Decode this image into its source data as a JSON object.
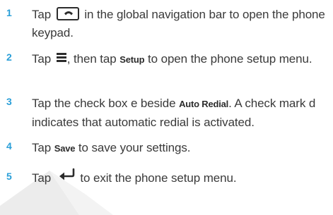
{
  "steps": [
    {
      "number": "1",
      "before_icon": "Tap ",
      "icon": "phone-handset-icon",
      "after_icon": " in the global navigation bar to open the phone keypad."
    },
    {
      "number": "2",
      "before_icon": "Tap ",
      "icon": "menu-icon",
      "after_icon": ", then tap ",
      "bold": "Setup",
      "after_bold": " to open the phone setup menu."
    },
    {
      "number": "3",
      "text_a": "Tap the check box e beside ",
      "bold": "Auto Redial",
      "text_b": ". A check mark d indicates that automatic redial is activated."
    },
    {
      "number": "4",
      "text_a": "Tap ",
      "bold": "Save",
      "text_b": " to save your settings."
    },
    {
      "number": "5",
      "before_icon": "Tap ",
      "icon": "back-arrow-icon",
      "after_icon": " to exit the phone setup menu."
    }
  ],
  "colors": {
    "step_number": "#2a9fd8",
    "body_text": "#3a3a3a",
    "watermark": "#e6e6e6"
  }
}
